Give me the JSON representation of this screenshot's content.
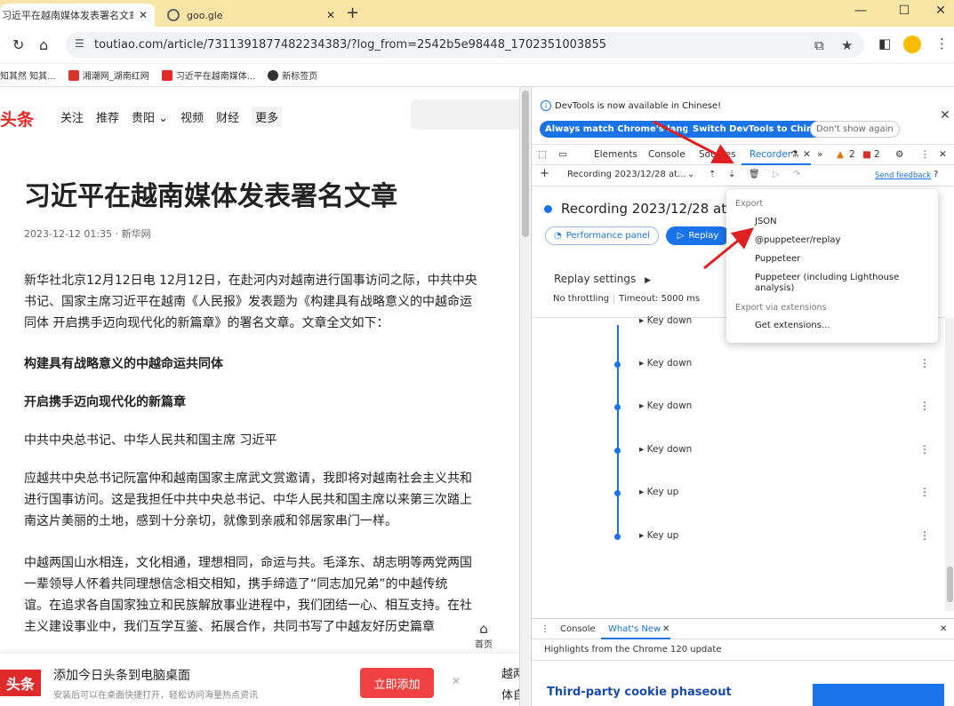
{
  "browser": {
    "tabs": [
      {
        "title": "习近平在越南媒体发表署名文章",
        "close": "✕"
      },
      {
        "title": "goo.gle",
        "close": "✕"
      }
    ],
    "new_tab": "+",
    "window_controls": {
      "minimize": "—",
      "maximize": "☐",
      "close": "✕"
    },
    "url": "toutiao.com/article/7311391877482234383/?log_from=2542b5e98448_1702351003855",
    "bookmarks": [
      "知其然 知其...",
      "湘潮网_湖南红网",
      "习近平在越南媒体...",
      "新标签页"
    ]
  },
  "page": {
    "logo": "头条",
    "nav": [
      "关注",
      "推荐",
      "贵阳 ⌄",
      "视频",
      "财经",
      "更多"
    ],
    "title": "习近平在越南媒体发表署名文章",
    "meta": "2023-12-12 01:35 · 新华网",
    "paragraphs": [
      "新华社北京12月12日电 12月12日，在赴河内对越南进行国事访问之际，中共中央",
      "书记、国家主席习近平在越南《人民报》发表题为《构建具有战略意义的中越命运",
      "同体 开启携手迈向现代化的新篇章》的署名文章。文章全文如下：",
      "构建具有战略意义的中越命运共同体",
      "开启携手迈向现代化的新篇章",
      "中共中央总书记、中华人民共和国主席 习近平",
      "应越共中央总书记阮富仲和越南国家主席武文赏邀请，我即将对越南社会主义共和",
      "进行国事访问。这是我担任中共中央总书记、中华人民共和国主席以来第三次踏上",
      "南这片美丽的土地，感到十分亲切，就像到亲戚和邻居家串门一样。",
      "中越两国山水相连，文化相通，理想相同，命运与共。毛泽东、胡志明等两党两国",
      "一辈领导人怀着共同理想信念相交相知，携手缔造了“同志加兄弟”的中越传统",
      "谊。在追求各自国家独立和民族解放事业进程中，我们团结一心、相互支持。在社",
      "主义建设事业中，我们互学互鉴、拓展合作，共同书写了中越友好历史篇章"
    ],
    "side_home": "首页",
    "side_feedback": "反馈",
    "banner": {
      "logo": "头条",
      "title": "添加今日头条到电脑桌面",
      "subtitle": "安装后可以在桌面快捷打开，轻松访问海量热点资讯",
      "button": "立即添加",
      "close": "✕",
      "tail": "越两党",
      "tail2": "体自"
    }
  },
  "devtools": {
    "info": "DevTools is now available in Chinese!",
    "btn_match": "Always match Chrome's language",
    "btn_switch": "Switch DevTools to Chinese",
    "btn_dont": "Don't show again",
    "tabs": [
      "Elements",
      "Console",
      "Sources",
      "Recorder"
    ],
    "badge_warn": "2",
    "badge_err": "2",
    "recording_select": "Recording 2023/12/28 at...",
    "send_feedback": "Send feedback",
    "recording_title": "Recording 2023/12/28 at",
    "performance_panel": "Performance panel",
    "replay": "Replay",
    "replay_settings": "Replay settings",
    "no_throttling": "No throttling",
    "timeout": "Timeout: 5000 ms",
    "steps": [
      "Key down",
      "Key down",
      "Key down",
      "Key down",
      "Key up",
      "Key up"
    ],
    "drawer_tabs": [
      "Console",
      "What's New"
    ],
    "highlights": "Highlights from the Chrome 120 update",
    "cookie_title": "Third-party cookie phaseout"
  },
  "export_menu": {
    "header": "Export",
    "items": [
      "JSON",
      "@puppeteer/replay",
      "Puppeteer",
      "Puppeteer (including Lighthouse analysis)"
    ],
    "ext_header": "Export via extensions",
    "get_extensions": "Get extensions..."
  }
}
